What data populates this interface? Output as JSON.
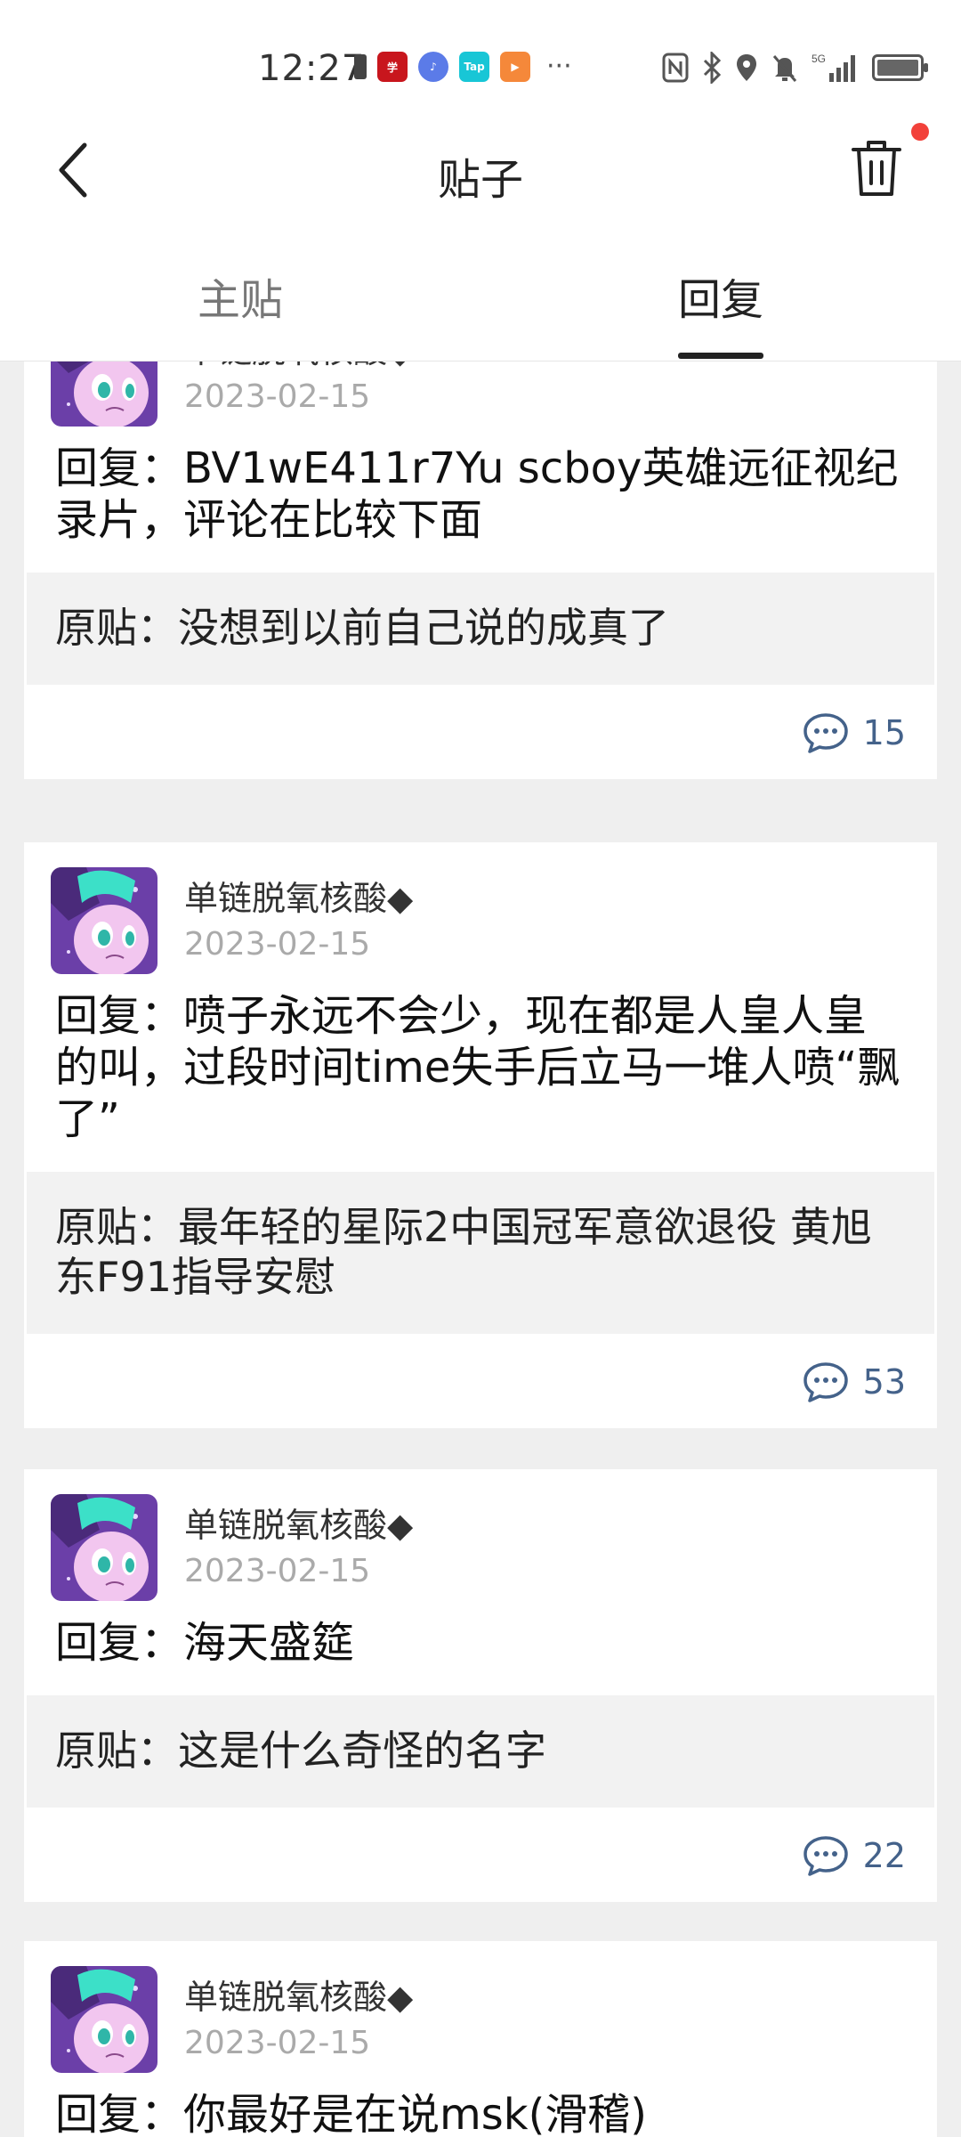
{
  "status_bar": {
    "time": "12:27",
    "network": "5G"
  },
  "header": {
    "title": "贴子"
  },
  "tabs": {
    "main": "主贴",
    "reply": "回复"
  },
  "posts": [
    {
      "author": "单链脱氧核酸◆",
      "date": "2023-02-15",
      "reply": "回复：BV1wE411r7Yu scboy英雄远征视纪录片，评论在比较下面",
      "original": "原贴：没想到以前自己说的成真了",
      "comments": "15"
    },
    {
      "author": "单链脱氧核酸◆",
      "date": "2023-02-15",
      "reply": "回复：喷子永远不会少，现在都是人皇人皇的叫，过段时间time失手后立马一堆人喷“飘了”",
      "original": "原贴：最年轻的星际2中国冠军意欲退役 黄旭东F91指导安慰",
      "comments": "53"
    },
    {
      "author": "单链脱氧核酸◆",
      "date": "2023-02-15",
      "reply": "回复：海天盛筵",
      "original": "原贴：这是什么奇怪的名字",
      "comments": "22"
    },
    {
      "author": "单链脱氧核酸◆",
      "date": "2023-02-15",
      "reply": "回复：你最好是在说msk(滑稽)"
    }
  ]
}
